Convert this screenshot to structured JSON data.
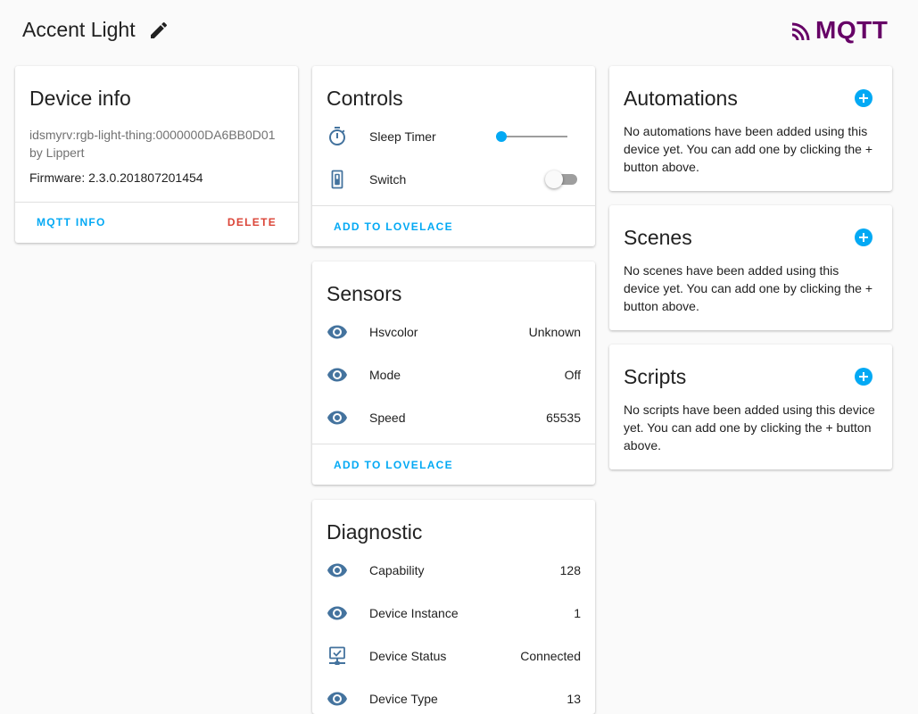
{
  "header": {
    "title": "Accent Light",
    "logo_text": "MQTT",
    "logo_color": "#660066"
  },
  "device_info": {
    "title": "Device info",
    "model": "idsmyrv:rgb-light-thing:0000000DA6BB0D01",
    "manufacturer": "by Lippert",
    "firmware": "Firmware: 2.3.0.201807201454",
    "mqtt_info_label": "MQTT INFO",
    "delete_label": "DELETE"
  },
  "controls": {
    "title": "Controls",
    "items": [
      {
        "label": "Sleep Timer",
        "icon": "timer-icon",
        "slider_value": 0
      },
      {
        "label": "Switch",
        "icon": "light-switch-icon",
        "state": "off"
      }
    ],
    "add_label": "ADD TO LOVELACE"
  },
  "sensors": {
    "title": "Sensors",
    "items": [
      {
        "label": "Hsvcolor",
        "value": "Unknown",
        "icon": "eye-icon"
      },
      {
        "label": "Mode",
        "value": "Off",
        "icon": "eye-icon"
      },
      {
        "label": "Speed",
        "value": "65535",
        "icon": "eye-icon"
      }
    ],
    "add_label": "ADD TO LOVELACE"
  },
  "diagnostic": {
    "title": "Diagnostic",
    "items": [
      {
        "label": "Capability",
        "value": "128",
        "icon": "eye-icon"
      },
      {
        "label": "Device Instance",
        "value": "1",
        "icon": "eye-icon"
      },
      {
        "label": "Device Status",
        "value": "Connected",
        "icon": "network-check-icon"
      },
      {
        "label": "Device Type",
        "value": "13",
        "icon": "eye-icon"
      }
    ]
  },
  "automations": {
    "title": "Automations",
    "text": "No automations have been added using this device yet. You can add one by clicking the + button above."
  },
  "scenes": {
    "title": "Scenes",
    "text": "No scenes have been added using this device yet. You can add one by clicking the + button above."
  },
  "scripts": {
    "title": "Scripts",
    "text": "No scripts have been added using this device yet. You can add one by clicking the + button above."
  },
  "colors": {
    "accent": "#03a9f4",
    "danger": "#db4437",
    "icon": "#44739e",
    "background": "#fafafa"
  }
}
